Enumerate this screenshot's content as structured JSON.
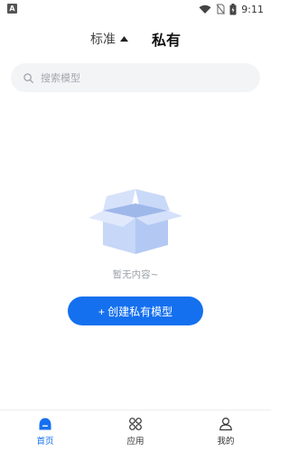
{
  "statusbar": {
    "time": "9:11",
    "left_icon": "A"
  },
  "header": {
    "tab_standard": "标准",
    "tab_private": "私有"
  },
  "search": {
    "placeholder": "搜索模型"
  },
  "empty": {
    "text": "暂无内容~"
  },
  "create_button": {
    "label": "+ 创建私有模型"
  },
  "bottom_nav": {
    "items": [
      {
        "label": "首页",
        "icon": "home-icon",
        "active": true
      },
      {
        "label": "应用",
        "icon": "apps-icon",
        "active": false
      },
      {
        "label": "我的",
        "icon": "profile-icon",
        "active": false
      }
    ]
  },
  "colors": {
    "accent": "#1570ef",
    "box_light": "#dbe6fb",
    "box_mid": "#c5d6f7",
    "box_dark": "#a9c2f1"
  }
}
